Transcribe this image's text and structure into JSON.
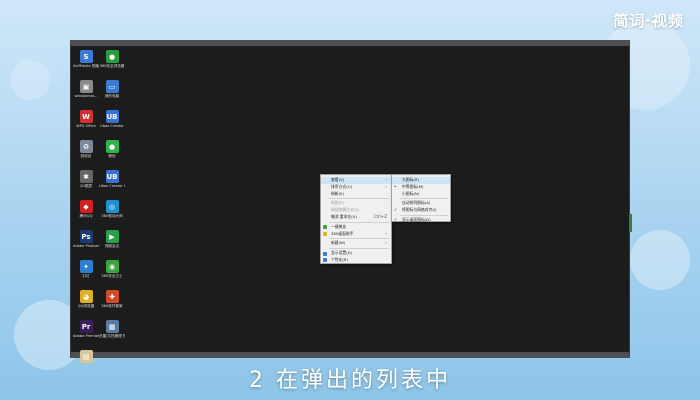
{
  "brand": {
    "text": "简词·视频"
  },
  "caption": {
    "text": "2 在弹出的列表中"
  },
  "desktop_icons": [
    {
      "name": "sefmedia-icon",
      "label": "SelfMedia 快播方式",
      "glyph": "S",
      "color": "#3b7bd4"
    },
    {
      "name": "wechat-group-icon",
      "label": "360安全浏览器",
      "glyph": "●",
      "color": "#2a9d3f"
    },
    {
      "name": "file-icon",
      "label": "wlanjiantai...",
      "glyph": "▣",
      "color": "#8a8a8a"
    },
    {
      "name": "computer-icon",
      "label": "我的电脑",
      "glyph": "▭",
      "color": "#3b7bd4"
    },
    {
      "name": "wps-icon",
      "label": "WPS Office",
      "glyph": "W",
      "color": "#d03030"
    },
    {
      "name": "spacer-icon",
      "label": "",
      "glyph": "",
      "color": "transparent"
    },
    {
      "name": "ubox-icon",
      "label": "Ubox Creator",
      "glyph": "UB",
      "color": "#3b6fd0"
    },
    {
      "name": "recycle-bin-icon",
      "label": "回收站",
      "glyph": "♻",
      "color": "#7a8a99"
    },
    {
      "name": "spacer-icon",
      "label": "",
      "glyph": "",
      "color": "transparent"
    },
    {
      "name": "wechat-icon",
      "label": "微信",
      "glyph": "●",
      "color": "#2fb34a"
    },
    {
      "name": "settings-icon",
      "label": "2D图层",
      "glyph": "✱",
      "color": "#666666"
    },
    {
      "name": "spacer-icon",
      "label": "",
      "glyph": "",
      "color": "transparent"
    },
    {
      "name": "ubox-creator-icon",
      "label": "Ubox Creator C...",
      "glyph": "UB",
      "color": "#3b6fd0"
    },
    {
      "name": "qq-icon",
      "label": "腾讯QQ",
      "glyph": "◆",
      "color": "#d02020"
    },
    {
      "name": "spacer-icon",
      "label": "",
      "glyph": "",
      "color": "transparent"
    },
    {
      "name": "360-icon",
      "label": "360驱动大师",
      "glyph": "◎",
      "color": "#1e90d0"
    },
    {
      "name": "photoshop-icon",
      "label": "Adobe Photosh...",
      "glyph": "Ps",
      "color": "#1d3b6e"
    },
    {
      "name": "spacer-icon",
      "label": "",
      "glyph": "",
      "color": "transparent"
    },
    {
      "name": "video-icon",
      "label": "视频会议",
      "glyph": "▶",
      "color": "#2aa04a"
    },
    {
      "name": "feather-icon",
      "label": "钉钉",
      "glyph": "✦",
      "color": "#2a7fd0"
    },
    {
      "name": "spacer-icon",
      "label": "",
      "glyph": "",
      "color": "transparent"
    },
    {
      "name": "360-safe-icon",
      "label": "360安全卫士",
      "glyph": "◉",
      "color": "#3aa53a"
    },
    {
      "name": "qq-browser-icon",
      "label": "QQ浏览器",
      "glyph": "◕",
      "color": "#e0b020"
    },
    {
      "name": "spacer-icon",
      "label": "",
      "glyph": "",
      "color": "transparent"
    },
    {
      "name": "360-manager-icon",
      "label": "360软件管家",
      "glyph": "✚",
      "color": "#d04a2a"
    },
    {
      "name": "premiere-icon",
      "label": "Adobe Premiere P...",
      "glyph": "Pr",
      "color": "#3a1f5c"
    },
    {
      "name": "spacer-icon",
      "label": "",
      "glyph": "",
      "color": "transparent"
    },
    {
      "name": "shortcut-icon",
      "label": "迅雷/文档管理 快捷方式101...",
      "glyph": "▦",
      "color": "#5a7aa0"
    },
    {
      "name": "text-file-icon",
      "label": "1",
      "glyph": "▤",
      "color": "#d8c79a"
    }
  ],
  "context_menu": {
    "items": [
      {
        "name": "menu-view",
        "label": "查看(V)",
        "arrow": "›",
        "highlight": true,
        "disabled": false,
        "icon_color": ""
      },
      {
        "name": "menu-sort",
        "label": "排序方式(O)",
        "arrow": "›",
        "highlight": false,
        "disabled": false,
        "icon_color": ""
      },
      {
        "name": "menu-refresh",
        "label": "刷新(E)",
        "arrow": "",
        "highlight": false,
        "disabled": false,
        "icon_color": ""
      },
      {
        "sep": true
      },
      {
        "name": "menu-paste",
        "label": "粘贴(P)",
        "arrow": "",
        "highlight": false,
        "disabled": true,
        "icon_color": ""
      },
      {
        "name": "menu-paste-shortcut",
        "label": "粘贴快捷方式(S)",
        "arrow": "",
        "highlight": false,
        "disabled": true,
        "icon_color": ""
      },
      {
        "name": "menu-undo",
        "label": "撤消 重命名(U)",
        "shortcut": "Ctrl+Z",
        "arrow": "",
        "highlight": false,
        "disabled": false,
        "icon_color": ""
      },
      {
        "sep": true
      },
      {
        "name": "menu-one-click",
        "label": "一键美化",
        "arrow": "",
        "highlight": false,
        "disabled": false,
        "icon_color": "#3aa53a"
      },
      {
        "name": "menu-desktop-organize",
        "label": "360桌面助手",
        "arrow": "›",
        "highlight": false,
        "disabled": false,
        "icon_color": "#e0b020"
      },
      {
        "sep": true
      },
      {
        "name": "menu-new",
        "label": "新建(W)",
        "arrow": "›",
        "highlight": false,
        "disabled": false,
        "icon_color": ""
      },
      {
        "sep": true
      },
      {
        "name": "menu-display",
        "label": "显示设置(D)",
        "arrow": "",
        "highlight": false,
        "disabled": false,
        "icon_color": "#3b7bd4"
      },
      {
        "name": "menu-personalize",
        "label": "个性化(R)",
        "arrow": "",
        "highlight": false,
        "disabled": false,
        "icon_color": "#3b7bd4"
      }
    ]
  },
  "submenu": {
    "items": [
      {
        "name": "sub-large-icons",
        "label": "大图标(R)",
        "check": "",
        "highlight": true
      },
      {
        "name": "sub-medium-icons",
        "label": "中等图标(M)",
        "check": "•",
        "highlight": false
      },
      {
        "name": "sub-small-icons",
        "label": "小图标(N)",
        "check": "",
        "highlight": false
      },
      {
        "sep": true
      },
      {
        "name": "sub-auto-arrange",
        "label": "自动排列图标(A)",
        "check": "",
        "highlight": false
      },
      {
        "name": "sub-align-grid",
        "label": "将图标与网格对齐(I)",
        "check": "✓",
        "highlight": false
      },
      {
        "sep": true
      },
      {
        "name": "sub-show-icons",
        "label": "显示桌面图标(D)",
        "check": "✓",
        "highlight": false
      }
    ]
  }
}
